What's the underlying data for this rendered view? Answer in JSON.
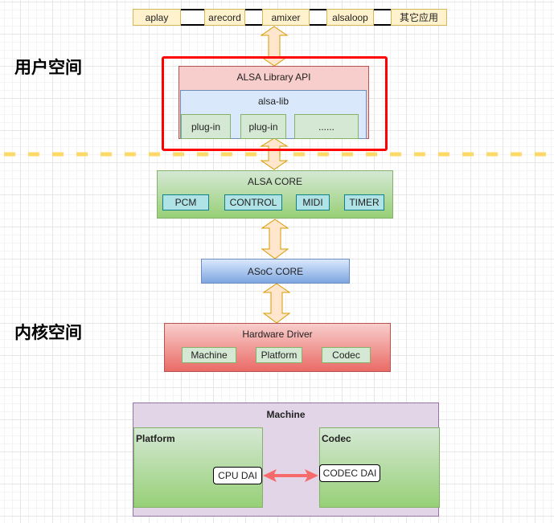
{
  "apps": [
    {
      "label": "aplay"
    },
    {
      "label": "arecord"
    },
    {
      "label": "amixer"
    },
    {
      "label": "alsaloop"
    },
    {
      "label": "其它应用"
    }
  ],
  "space_labels": {
    "user": "用户空间",
    "kernel": "内核空间"
  },
  "user_space": {
    "library_api": "ALSA Library API",
    "alsa_lib": "alsa-lib",
    "plugins": [
      "plug-in",
      "plug-in",
      "......"
    ]
  },
  "alsa_core": {
    "title": "ALSA CORE",
    "modules": [
      "PCM",
      "CONTROL",
      "MIDI",
      "TIMER"
    ]
  },
  "asoc_core": {
    "title": "ASoC CORE"
  },
  "hardware_driver": {
    "title": "Hardware Driver",
    "parts": [
      "Machine",
      "Platform",
      "Codec"
    ]
  },
  "machine_detail": {
    "title": "Machine",
    "platform": {
      "title": "Platform",
      "dai": "CPU DAI"
    },
    "codec": {
      "title": "Codec",
      "dai": "CODEC DAI"
    }
  },
  "colors": {
    "highlight_border": "#ff0000",
    "divider": "#ffd966",
    "arrow_fill": "#ffe6cc",
    "arrow_stroke": "#d79b00",
    "dai_link": "#f56a6a"
  }
}
